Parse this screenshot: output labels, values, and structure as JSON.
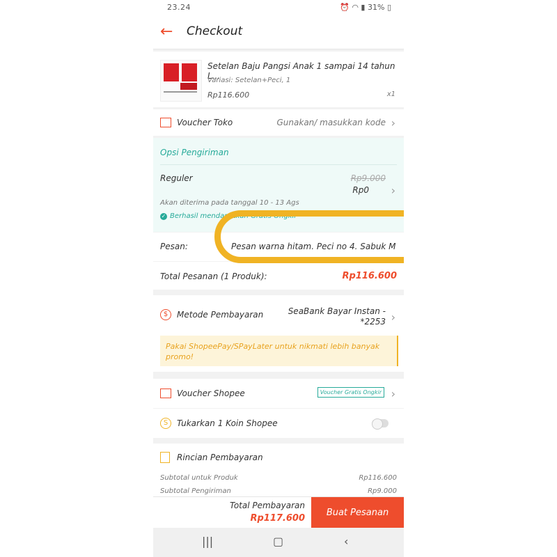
{
  "status_bar": {
    "time": "23.24",
    "battery": "31%"
  },
  "header": {
    "title": "Checkout"
  },
  "product": {
    "name": "Setelan Baju Pangsi Anak 1 sampai 14 tahun L...",
    "variant": "Variasi: Setelan+Peci, 1",
    "price": "Rp116.600",
    "qty": "x1"
  },
  "voucher_toko": {
    "label": "Voucher Toko",
    "action": "Gunakan/ masukkan kode"
  },
  "shipping": {
    "section_title": "Opsi Pengiriman",
    "method": "Reguler",
    "old_price": "Rp9.000",
    "price": "Rp0",
    "eta": "Akan diterima pada tanggal 10 - 13 Ags",
    "free_note": "Berhasil mendapatkan Gratis Ongkir"
  },
  "message": {
    "label": "Pesan:",
    "value": "Pesan warna hitam. Peci no 4. Sabuk M"
  },
  "order_total": {
    "label": "Total Pesanan (1 Produk):",
    "value": "Rp116.600"
  },
  "payment": {
    "label": "Metode Pembayaran",
    "method_line1": "SeaBank Bayar Instan -",
    "method_line2": "*2253",
    "promo": "Pakai ShopeePay/SPayLater untuk nikmati lebih banyak promo!"
  },
  "voucher_shopee": {
    "label": "Voucher Shopee",
    "badge": "Voucher Gratis Ongkir"
  },
  "coins": {
    "label": "Tukarkan 1 Koin Shopee",
    "toggle_on": false
  },
  "payment_details": {
    "title": "Rincian Pembayaran",
    "subtotal_product_label": "Subtotal untuk Produk",
    "subtotal_product_value": "Rp116.600",
    "subtotal_shipping_label": "Subtotal Pengiriman",
    "subtotal_shipping_value": "Rp9.000"
  },
  "footer": {
    "total_label": "Total Pembayaran",
    "total_value": "Rp117.600",
    "button": "Buat Pesanan"
  },
  "colors": {
    "accent": "#ee4d2d",
    "teal": "#26aa99",
    "highlight": "#f0b324"
  }
}
